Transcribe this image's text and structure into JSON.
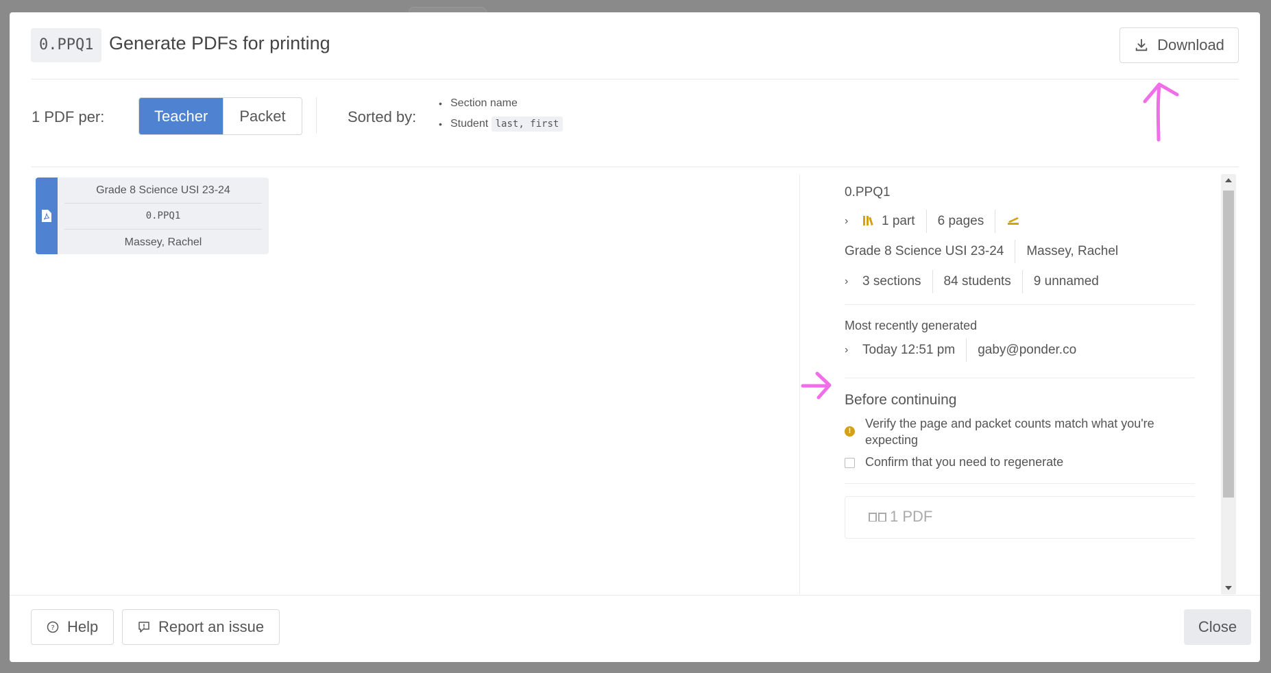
{
  "modal": {
    "code": "0.PPQ1",
    "title": "Generate PDFs for printing",
    "download_label": "Download"
  },
  "options": {
    "per_label": "1 PDF per:",
    "per_choices": [
      "Teacher",
      "Packet"
    ],
    "per_selected": "Teacher",
    "sorted_label": "Sorted by:",
    "sort_items": [
      {
        "text": "Section name",
        "code": ""
      },
      {
        "text": "Student",
        "code": "last, first"
      }
    ]
  },
  "pdf_card": {
    "course": "Grade 8 Science USI 23-24",
    "code": "0.PPQ1",
    "teacher": "Massey, Rachel"
  },
  "details": {
    "code": "0.PPQ1",
    "parts": "1 part",
    "pages": "6 pages",
    "course": "Grade 8 Science USI 23-24",
    "teacher": "Massey, Rachel",
    "sections": "3 sections",
    "students": "84 students",
    "unnamed": "9 unnamed",
    "recent_heading": "Most recently generated",
    "recent_time": "Today 12:51 pm",
    "recent_user": "gaby@ponder.co",
    "before_heading": "Before continuing",
    "warning_text": "Verify the page and packet counts match what you're expecting",
    "confirm_text": "Confirm that you need to regenerate",
    "pdf_count": "1 PDF"
  },
  "footer": {
    "help_label": "Help",
    "report_label": "Report an issue",
    "close_label": "Close"
  },
  "colors": {
    "accent": "#4f82d1",
    "warning": "#d4a017",
    "annotation": "#f06ee8"
  }
}
